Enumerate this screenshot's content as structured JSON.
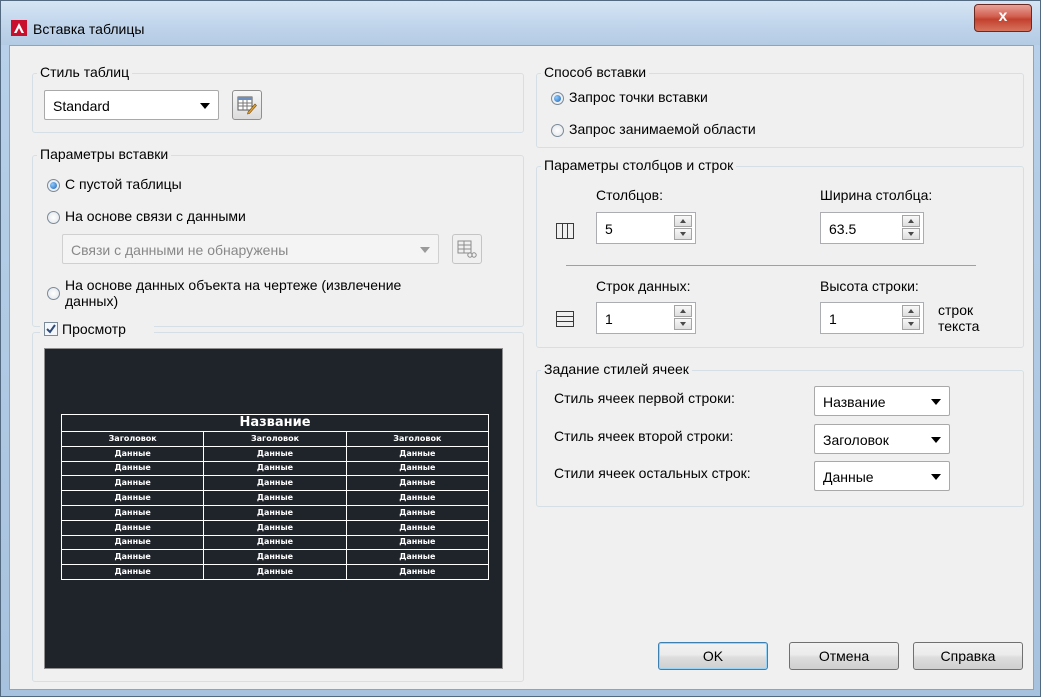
{
  "window": {
    "title": "Вставка таблицы",
    "close_label": "x"
  },
  "table_style": {
    "group_label": "Стиль таблиц",
    "selected": "Standard"
  },
  "insert_options": {
    "group_label": "Параметры вставки",
    "options": [
      {
        "label": "С пустой таблицы",
        "checked": true
      },
      {
        "label": "На основе связи с данными",
        "checked": false
      },
      {
        "label": "На основе данных объекта на чертеже (извлечение",
        "label2": "данных)",
        "checked": false
      }
    ],
    "data_link_placeholder": "Связи с данными не обнаружены"
  },
  "preview": {
    "checkbox_label": "Просмотр",
    "checked": true,
    "table_title": "Название",
    "header_cells": [
      "Заголовок",
      "Заголовок",
      "Заголовок"
    ],
    "data_rows": [
      [
        "Данные",
        "Данные",
        "Данные"
      ],
      [
        "Данные",
        "Данные",
        "Данные"
      ],
      [
        "Данные",
        "Данные",
        "Данные"
      ],
      [
        "Данные",
        "Данные",
        "Данные"
      ],
      [
        "Данные",
        "Данные",
        "Данные"
      ],
      [
        "Данные",
        "Данные",
        "Данные"
      ],
      [
        "Данные",
        "Данные",
        "Данные"
      ],
      [
        "Данные",
        "Данные",
        "Данные"
      ],
      [
        "Данные",
        "Данные",
        "Данные"
      ]
    ]
  },
  "insert_method": {
    "group_label": "Способ вставки",
    "options": [
      {
        "label": "Запрос точки вставки",
        "checked": true
      },
      {
        "label": "Запрос занимаемой области",
        "checked": false
      }
    ]
  },
  "col_row": {
    "group_label": "Параметры столбцов и строк",
    "columns_label": "Столбцов:",
    "columns_value": "5",
    "col_width_label": "Ширина столбца:",
    "col_width_value": "63.5",
    "data_rows_label": "Строк данных:",
    "data_rows_value": "1",
    "row_height_label": "Высота строки:",
    "row_height_value": "1",
    "row_height_unit_1": "строк",
    "row_height_unit_2": "текста"
  },
  "cell_styles": {
    "group_label": "Задание стилей ячеек",
    "first_row_label": "Стиль ячеек первой строки:",
    "first_row_value": "Название",
    "second_row_label": "Стиль ячеек второй строки:",
    "second_row_value": "Заголовок",
    "other_rows_label": "Стили ячеек остальных строк:",
    "other_rows_value": "Данные"
  },
  "buttons": {
    "ok": "OK",
    "cancel": "Отмена",
    "help": "Справка"
  }
}
